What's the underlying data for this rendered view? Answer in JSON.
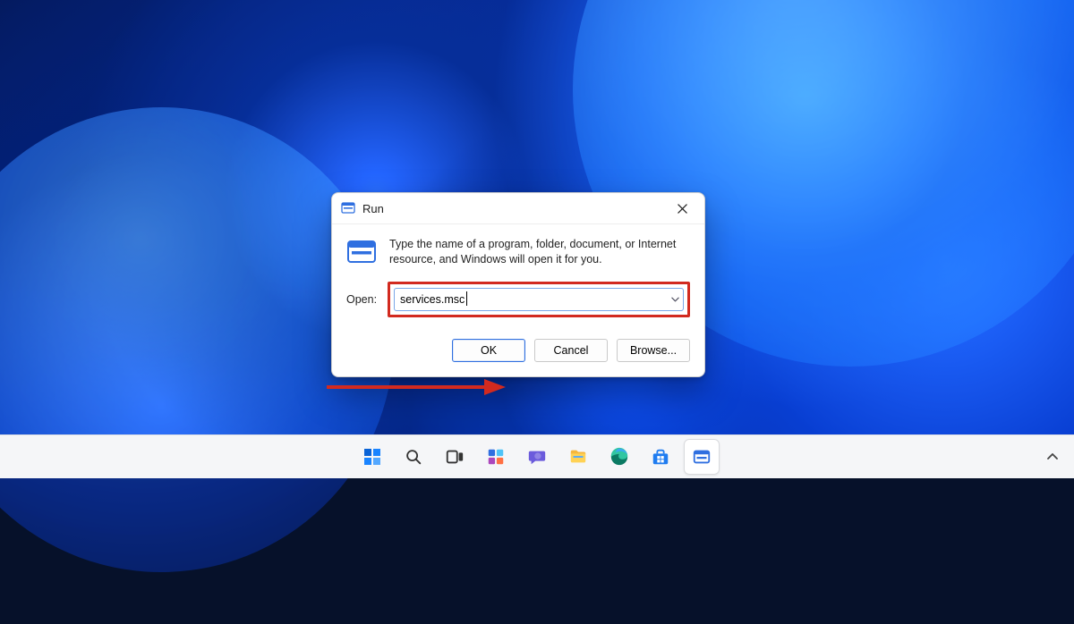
{
  "dialog": {
    "title": "Run",
    "description": "Type the name of a program, folder, document, or Internet resource, and Windows will open it for you.",
    "open_label": "Open:",
    "open_value": "services.msc",
    "buttons": {
      "ok": "OK",
      "cancel": "Cancel",
      "browse": "Browse..."
    }
  },
  "taskbar": {
    "items": [
      {
        "name": "start",
        "label": "Start"
      },
      {
        "name": "search",
        "label": "Search"
      },
      {
        "name": "task-view",
        "label": "Task View"
      },
      {
        "name": "widgets",
        "label": "Widgets"
      },
      {
        "name": "chat",
        "label": "Chat"
      },
      {
        "name": "file-explorer",
        "label": "File Explorer"
      },
      {
        "name": "edge",
        "label": "Microsoft Edge"
      },
      {
        "name": "store",
        "label": "Microsoft Store"
      },
      {
        "name": "run-app",
        "label": "Run"
      }
    ]
  },
  "colors": {
    "annotation": "#d22a1f",
    "accent": "#2f6fe0"
  }
}
